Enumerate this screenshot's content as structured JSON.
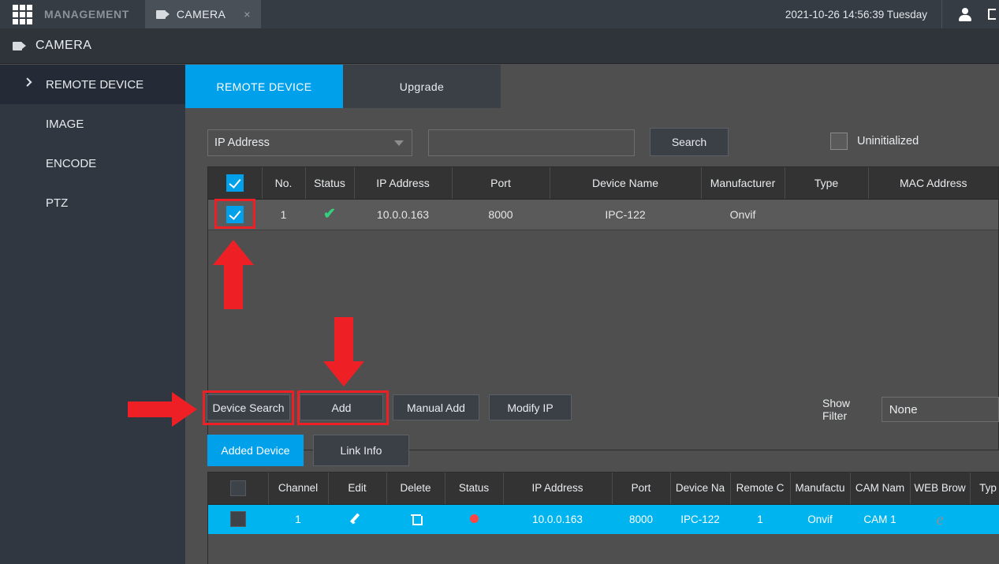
{
  "topbar": {
    "grid_icon": "grid-icon",
    "management_label": "MANAGEMENT",
    "camera_tab": {
      "icon": "camera-icon",
      "label": "CAMERA",
      "close": "×"
    },
    "datetime": "2021-10-26 14:56:39 Tuesday",
    "user_icon": "person-icon"
  },
  "pagetitle": {
    "icon": "camera-icon",
    "title": "CAMERA"
  },
  "sidebar": {
    "items": [
      {
        "label": "REMOTE DEVICE",
        "active": true,
        "chevron": "chevron-right-icon"
      },
      {
        "label": "IMAGE",
        "active": false
      },
      {
        "label": "ENCODE",
        "active": false
      },
      {
        "label": "PTZ",
        "active": false
      }
    ]
  },
  "tabs": [
    {
      "label": "REMOTE DEVICE",
      "active": true
    },
    {
      "label": "Upgrade",
      "active": false
    }
  ],
  "search": {
    "filter_select": "IP Address",
    "filter_caret": "chevron-down-icon",
    "input_value": "",
    "input_placeholder": "",
    "search_button": "Search",
    "uninitialized_label": "Uninitialized",
    "uninitialized_checked": false
  },
  "device_table": {
    "header_checkbox_checked": true,
    "columns": [
      "",
      "No.",
      "Status",
      "IP Address",
      "Port",
      "Device Name",
      "Manufacturer",
      "Type",
      "MAC Address"
    ],
    "rows": [
      {
        "checked": true,
        "no": "1",
        "status": "✔",
        "ip_address": "10.0.0.163",
        "port": "8000",
        "device_name": "IPC-122",
        "manufacturer": "Onvif",
        "type": "",
        "mac_address": ""
      }
    ]
  },
  "actions": {
    "device_search": "Device Search",
    "add": "Add",
    "manual_add": "Manual Add",
    "modify_ip": "Modify IP",
    "show_filter_label": "Show Filter",
    "show_filter_value": "None"
  },
  "subtabs": [
    {
      "label": "Added Device",
      "active": true
    },
    {
      "label": "Link Info",
      "active": false
    }
  ],
  "added_table": {
    "columns": [
      "",
      "Channel",
      "Edit",
      "Delete",
      "Status",
      "IP Address",
      "Port",
      "Device Na",
      "Remote C",
      "Manufactu",
      "CAM Nam",
      "WEB Brow",
      "Typ"
    ],
    "rows": [
      {
        "checked": false,
        "channel": "1",
        "edit": "pencil-icon",
        "delete": "trash-icon",
        "status": "status-dot-red",
        "ip_address": "10.0.0.163",
        "port": "8000",
        "device_name": "IPC-122",
        "remote_channel": "1",
        "manufacturer": "Onvif",
        "cam_name": "CAM 1",
        "web_browser": "edge-browser-icon",
        "type": ""
      }
    ]
  },
  "annotations": {
    "color": "#ee2026",
    "arrow_up": "arrow-up-annotation",
    "arrow_down": "arrow-down-annotation",
    "arrow_right": "arrow-right-annotation",
    "highlight_checkbox": "highlight-row-checkbox",
    "highlight_device_search": "highlight-device-search",
    "highlight_add": "highlight-add"
  },
  "colors": {
    "accent_blue": "#00a0eb",
    "row_highlight": "#00b4f0",
    "annotation_red": "#ee2026",
    "status_green": "#35d07f",
    "status_red": "#ff4444"
  }
}
